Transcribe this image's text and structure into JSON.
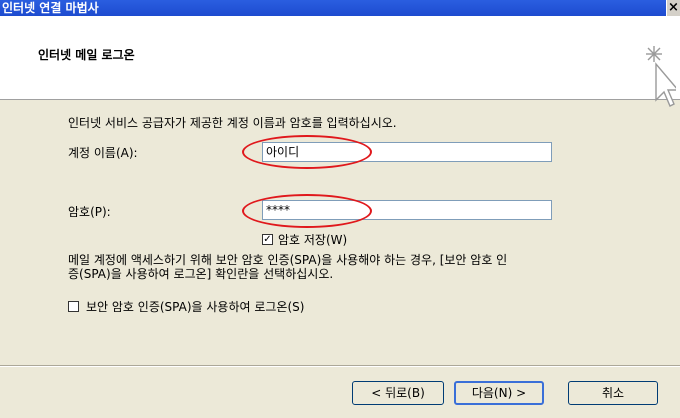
{
  "window": {
    "title": "인터넷 연결 마법사",
    "close_label": "×"
  },
  "header": {
    "title": "인터넷 메일 로그온",
    "icon": "wizard-sparkle-cursor-icon"
  },
  "body": {
    "instruction": "인터넷 서비스 공급자가 제공한 계정 이름과 암호를 입력하십시오.",
    "account_label": "계정 이름(A):",
    "account_value": "아이디",
    "password_label": "암호(P):",
    "password_value": "****",
    "remember_label": "암호 저장(W)",
    "remember_checked": true,
    "spa_note_line1": "메일 계정에 액세스하기 위해 보안 암호 인증(SPA)을 사용해야 하는 경우, [보안 암호 인",
    "spa_note_line2": "증(SPA)을 사용하여 로그온] 확인란을 선택하십시오.",
    "spa_label": "보안 암호 인증(SPA)을 사용하여 로그온(S)",
    "spa_checked": false
  },
  "buttons": {
    "back": "< 뒤로(B)",
    "next": "다음(N) >",
    "cancel": "취소"
  },
  "colors": {
    "titlebar": "#2a5ee0",
    "annotation_circle": "#e0181c",
    "dialog_bg": "#ece9d8"
  }
}
